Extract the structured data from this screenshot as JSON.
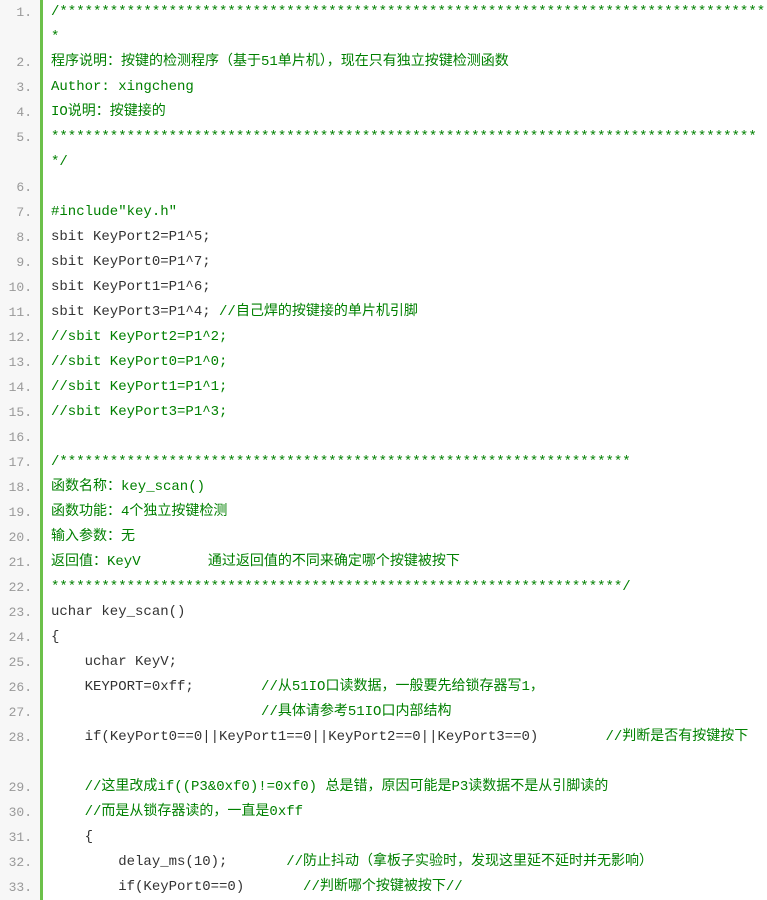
{
  "lines": [
    {
      "n": "1.",
      "tall": true,
      "parts": [
        {
          "c": "cm",
          "t": "/*************************************************************************************"
        }
      ]
    },
    {
      "n": "2.",
      "parts": [
        {
          "c": "cm",
          "t": "程序说明：按键的检测程序（基于51单片机），现在只有独立按键检测函数"
        }
      ]
    },
    {
      "n": "3.",
      "parts": [
        {
          "c": "cm",
          "t": "Author: xingcheng"
        }
      ]
    },
    {
      "n": "4.",
      "parts": [
        {
          "c": "cm",
          "t": "IO说明：按键接的"
        }
      ]
    },
    {
      "n": "5.",
      "tall": true,
      "parts": [
        {
          "c": "cm",
          "t": "*************************************************************************************/"
        }
      ]
    },
    {
      "n": "6.",
      "parts": [
        {
          "c": "",
          "t": ""
        }
      ]
    },
    {
      "n": "7.",
      "parts": [
        {
          "c": "cm",
          "t": "#include\"key.h\""
        }
      ]
    },
    {
      "n": "8.",
      "parts": [
        {
          "c": "kw",
          "t": "sbit KeyPort2=P1^5;"
        }
      ]
    },
    {
      "n": "9.",
      "parts": [
        {
          "c": "kw",
          "t": "sbit KeyPort0=P1^7;"
        }
      ]
    },
    {
      "n": "10.",
      "parts": [
        {
          "c": "kw",
          "t": "sbit KeyPort1=P1^6;"
        }
      ]
    },
    {
      "n": "11.",
      "parts": [
        {
          "c": "kw",
          "t": "sbit KeyPort3=P1^4; "
        },
        {
          "c": "cm",
          "t": "//自己焊的按键接的单片机引脚"
        }
      ]
    },
    {
      "n": "12.",
      "parts": [
        {
          "c": "cm",
          "t": "//sbit KeyPort2=P1^2;"
        }
      ]
    },
    {
      "n": "13.",
      "parts": [
        {
          "c": "cm",
          "t": "//sbit KeyPort0=P1^0;"
        }
      ]
    },
    {
      "n": "14.",
      "parts": [
        {
          "c": "cm",
          "t": "//sbit KeyPort1=P1^1;"
        }
      ]
    },
    {
      "n": "15.",
      "parts": [
        {
          "c": "cm",
          "t": "//sbit KeyPort3=P1^3;"
        }
      ]
    },
    {
      "n": "16.",
      "parts": [
        {
          "c": "",
          "t": ""
        }
      ]
    },
    {
      "n": "17.",
      "parts": [
        {
          "c": "cm",
          "t": "/********************************************************************"
        }
      ]
    },
    {
      "n": "18.",
      "parts": [
        {
          "c": "cm",
          "t": "函数名称：key_scan()"
        }
      ]
    },
    {
      "n": "19.",
      "parts": [
        {
          "c": "cm",
          "t": "函数功能：4个独立按键检测"
        }
      ]
    },
    {
      "n": "20.",
      "parts": [
        {
          "c": "cm",
          "t": "输入参数：无"
        }
      ]
    },
    {
      "n": "21.",
      "parts": [
        {
          "c": "cm",
          "t": "返回值：KeyV        通过返回值的不同来确定哪个按键被按下"
        }
      ]
    },
    {
      "n": "22.",
      "parts": [
        {
          "c": "cm",
          "t": "********************************************************************/"
        }
      ]
    },
    {
      "n": "23.",
      "parts": [
        {
          "c": "kw",
          "t": "uchar key_scan()"
        }
      ]
    },
    {
      "n": "24.",
      "parts": [
        {
          "c": "kw",
          "t": "{"
        }
      ]
    },
    {
      "n": "25.",
      "parts": [
        {
          "c": "kw",
          "t": "    uchar KeyV;"
        }
      ]
    },
    {
      "n": "26.",
      "parts": [
        {
          "c": "kw",
          "t": "    KEYPORT=0xff;        "
        },
        {
          "c": "cm",
          "t": "//从51IO口读数据，一般要先给锁存器写1，"
        }
      ]
    },
    {
      "n": "27.",
      "parts": [
        {
          "c": "kw",
          "t": "                         "
        },
        {
          "c": "cm",
          "t": "//具体请参考51IO口内部结构"
        }
      ]
    },
    {
      "n": "28.",
      "tall": true,
      "parts": [
        {
          "c": "kw",
          "t": "    if(KeyPort0==0||KeyPort1==0||KeyPort2==0||KeyPort3==0)        "
        },
        {
          "c": "cm",
          "t": "//判断是否有按键按下"
        }
      ]
    },
    {
      "n": "29.",
      "parts": [
        {
          "c": "kw",
          "t": "    "
        },
        {
          "c": "cm",
          "t": "//这里改成if((P3&0xf0)!=0xf0) 总是错，原因可能是P3读数据不是从引脚读的"
        }
      ]
    },
    {
      "n": "30.",
      "parts": [
        {
          "c": "kw",
          "t": "    "
        },
        {
          "c": "cm",
          "t": "//而是从锁存器读的，一直是0xff"
        }
      ]
    },
    {
      "n": "31.",
      "parts": [
        {
          "c": "kw",
          "t": "    {"
        }
      ]
    },
    {
      "n": "32.",
      "parts": [
        {
          "c": "kw",
          "t": "        delay_ms(10);       "
        },
        {
          "c": "cm",
          "t": "//防止抖动（拿板子实验时，发现这里延不延时并无影响）"
        }
      ]
    },
    {
      "n": "33.",
      "parts": [
        {
          "c": "kw",
          "t": "        if(KeyPort0==0)       "
        },
        {
          "c": "cm",
          "t": "//判断哪个按键被按下//"
        }
      ]
    }
  ]
}
